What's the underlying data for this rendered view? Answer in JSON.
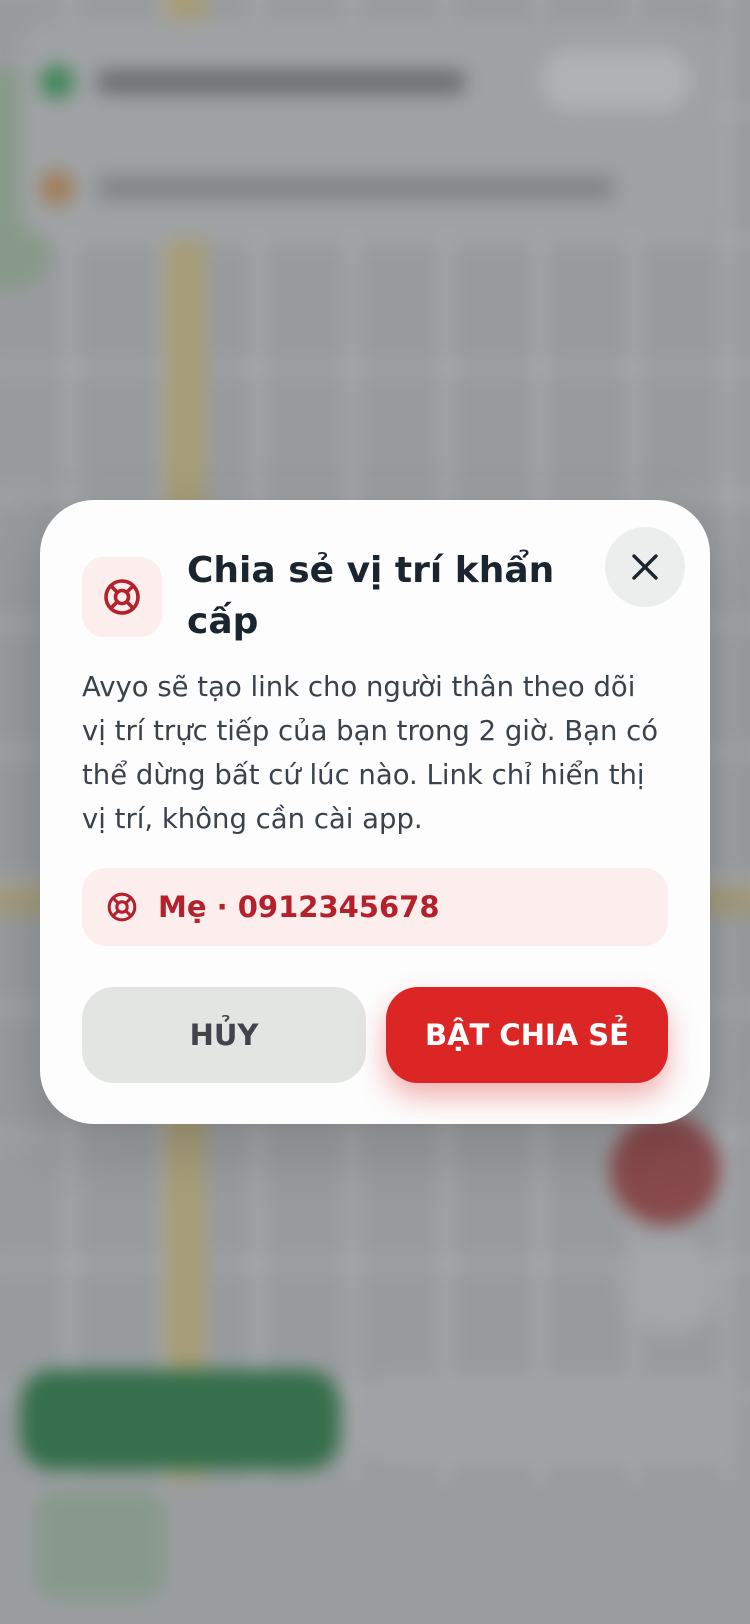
{
  "modal": {
    "title": "Chia sẻ vị trí khẩn cấp",
    "description": "Avyo sẽ tạo link cho người thân theo dõi vị trí trực tiếp của bạn trong 2 giờ. Bạn có thể dừng bất cứ lúc nào. Link chỉ hiển thị vị trí, không cần cài app.",
    "contact": "Mẹ · 0912345678",
    "cancel_label": "HỦY",
    "confirm_label": "BẬT CHIA SẺ"
  },
  "icons": {
    "header": "lifebuoy-icon",
    "close": "close-icon",
    "contact": "lifebuoy-icon"
  },
  "colors": {
    "accent_red": "#dc2626",
    "contact_text": "#b5212b",
    "icon_bg": "#fdeeee",
    "title": "#1b2530"
  }
}
